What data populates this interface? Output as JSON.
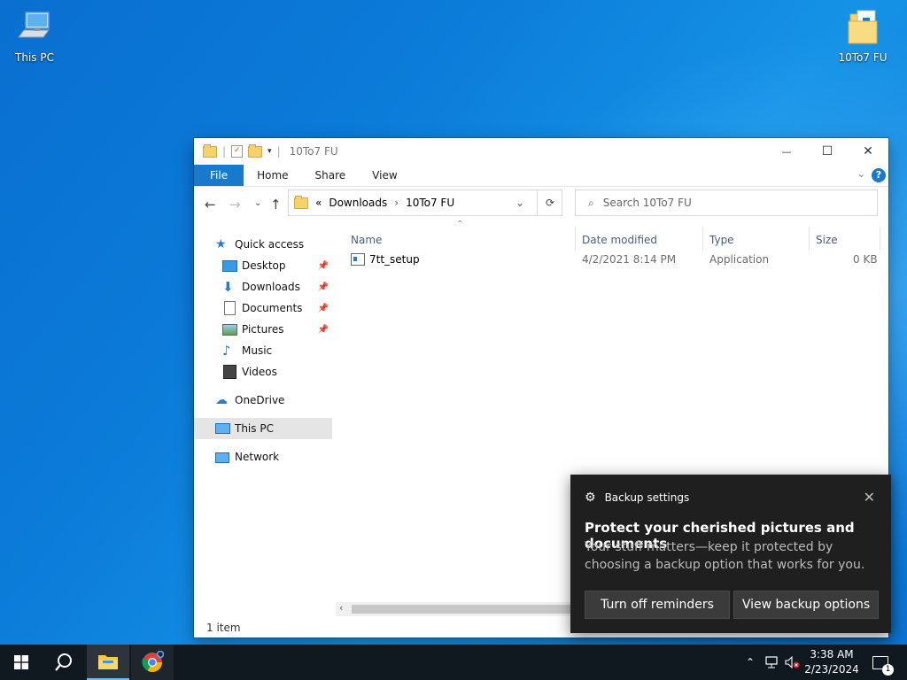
{
  "desktop": {
    "icons": [
      {
        "label": "This PC"
      },
      {
        "label": "10To7 FU"
      }
    ]
  },
  "explorer": {
    "title": "10To7 FU",
    "window_controls": {
      "minimize": "—",
      "maximize": "☐",
      "close": "✕"
    },
    "ribbon_tabs": [
      "File",
      "Home",
      "Share",
      "View"
    ],
    "help_label": "?",
    "address": {
      "prefix": "«",
      "segments": [
        "Downloads",
        "10To7 FU"
      ]
    },
    "search": {
      "placeholder": "Search 10To7 FU"
    },
    "nav": {
      "quick_access": "Quick access",
      "items": [
        {
          "label": "Desktop",
          "pinned": true
        },
        {
          "label": "Downloads",
          "pinned": true
        },
        {
          "label": "Documents",
          "pinned": true
        },
        {
          "label": "Pictures",
          "pinned": true
        },
        {
          "label": "Music",
          "pinned": false
        },
        {
          "label": "Videos",
          "pinned": false
        }
      ],
      "onedrive": "OneDrive",
      "this_pc": "This PC",
      "network": "Network"
    },
    "columns": [
      "Name",
      "Date modified",
      "Type",
      "Size"
    ],
    "files": [
      {
        "name": "7tt_setup",
        "date": "4/2/2021 8:14 PM",
        "type": "Application",
        "size": "0 KB"
      }
    ],
    "status": "1 item"
  },
  "toast": {
    "app": "Backup settings",
    "title": "Protect your cherished pictures and documents",
    "body": "Your stuff matters—keep it protected by choosing a backup option that works for you.",
    "buttons": [
      "Turn off reminders",
      "View backup options"
    ],
    "close": "✕"
  },
  "taskbar": {
    "time": "3:38 AM",
    "date": "2/23/2024",
    "notification_count": "1"
  },
  "colors": {
    "accent": "#1979ca",
    "toast_bg": "#1f1f1f",
    "taskbar_bg": "#101820"
  }
}
